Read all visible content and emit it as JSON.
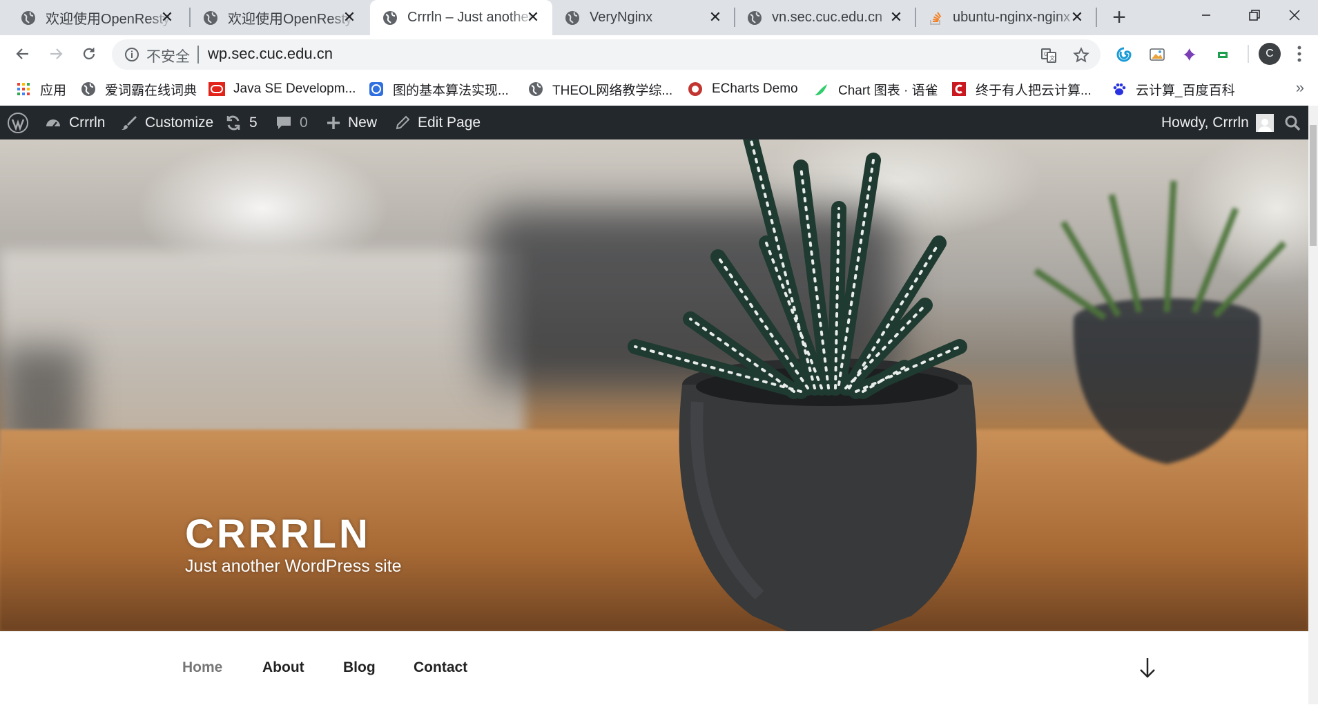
{
  "browser": {
    "tabs": [
      {
        "title": "欢迎使用OpenResty",
        "active": false
      },
      {
        "title": "欢迎使用OpenResty",
        "active": false
      },
      {
        "title": "Crrrln – Just another WordPress site",
        "active": true
      },
      {
        "title": "VeryNginx",
        "active": false
      },
      {
        "title": "vn.sec.cuc.edu.cn",
        "active": false
      },
      {
        "title": "ubuntu-nginx-nginx",
        "active": false
      }
    ],
    "new_tab_label": "+",
    "address_bar": {
      "security_label": "不安全",
      "url": "wp.sec.cuc.edu.cn"
    },
    "profile_initial": "C",
    "bookmarks": [
      {
        "label": "应用",
        "icon": "apps-grid-icon"
      },
      {
        "label": "爱词霸在线词典",
        "icon": "globe-icon"
      },
      {
        "label": "Java SE Developm...",
        "icon": "oracle-icon"
      },
      {
        "label": "图的基本算法实现...",
        "icon": "blue-logo-icon"
      },
      {
        "label": "THEOL网络教学综...",
        "icon": "globe-icon"
      },
      {
        "label": "ECharts Demo",
        "icon": "echarts-icon"
      },
      {
        "label": "Chart 图表 · 语雀",
        "icon": "yuque-icon"
      },
      {
        "label": "终于有人把云计算...",
        "icon": "csdn-icon"
      },
      {
        "label": "云计算_百度百科",
        "icon": "baidu-paw-icon"
      }
    ],
    "bookmarks_more": "»",
    "accent": "#1a73e8"
  },
  "admin_bar": {
    "site_name": "Crrrln",
    "customize": "Customize",
    "updates_count": "5",
    "comments_count": "0",
    "new_label": "New",
    "edit_label": "Edit Page",
    "howdy": "Howdy, Crrrln",
    "bg_color": "#23282d"
  },
  "site": {
    "title": "CRRRLN",
    "tagline": "Just another WordPress site",
    "nav": [
      {
        "label": "Home",
        "current": true
      },
      {
        "label": "About",
        "current": false
      },
      {
        "label": "Blog",
        "current": false
      },
      {
        "label": "Contact",
        "current": false
      }
    ]
  }
}
